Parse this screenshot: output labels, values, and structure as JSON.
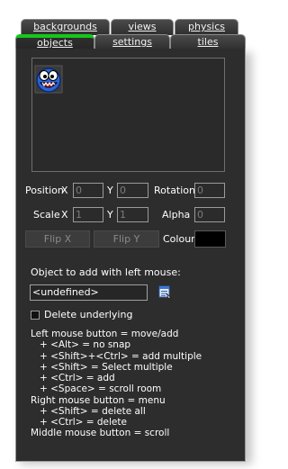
{
  "tabs": {
    "back": [
      {
        "label": "backgrounds"
      },
      {
        "label": "views"
      },
      {
        "label": "physics"
      }
    ],
    "front": [
      {
        "label": "objects",
        "active": true
      },
      {
        "label": "settings"
      },
      {
        "label": "tiles"
      }
    ]
  },
  "room": {
    "instance_icon": "blue-round-monster-sprite-icon"
  },
  "props": {
    "position_label": "Position",
    "x_label": "X",
    "y_label": "Y",
    "position_x": "0",
    "position_y": "0",
    "rotation_label": "Rotation",
    "rotation_value": "0",
    "scale_label": "Scale",
    "scale_x": "1",
    "scale_y": "1",
    "alpha_label": "Alpha",
    "alpha_value": "0",
    "flip_x_label": "Flip X",
    "flip_y_label": "Flip Y",
    "colour_label": "Colour",
    "colour_value": "#000000"
  },
  "object": {
    "prompt": "Object to add with left mouse:",
    "value": "<undefined>",
    "browse_icon": "object-list-icon",
    "delete_underlying_label": "Delete underlying",
    "delete_underlying_checked": false
  },
  "help_lines": [
    {
      "text": "Left mouse button = move/add",
      "indent": false
    },
    {
      "text": "+ <Alt> = no snap",
      "indent": true
    },
    {
      "text": "+ <Shift>+<Ctrl> = add multiple",
      "indent": true
    },
    {
      "text": "+ <Shift> = Select multiple",
      "indent": true
    },
    {
      "text": "+ <Ctrl> = add",
      "indent": true
    },
    {
      "text": "+ <Space> = scroll room",
      "indent": true
    },
    {
      "text": "Right mouse button = menu",
      "indent": false
    },
    {
      "text": "+ <Shift> = delete all",
      "indent": true
    },
    {
      "text": "+ <Ctrl> = delete",
      "indent": true
    },
    {
      "text": "Middle mouse button = scroll",
      "indent": false
    }
  ],
  "colors": {
    "panel": "#2d2d2d",
    "active_tab_accent": "#15c71b",
    "text": "#ffffff",
    "disabled_text": "#7d7d7d"
  }
}
